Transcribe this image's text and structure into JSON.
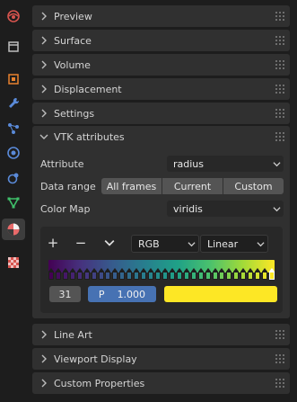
{
  "tabs": [
    {
      "name": "tool-tab",
      "icon": "tool-icon"
    },
    {
      "name": "render-tab",
      "icon": "render-icon"
    },
    {
      "name": "object-tab",
      "icon": "object-icon"
    },
    {
      "name": "modifiers-tab",
      "icon": "wrench-icon"
    },
    {
      "name": "particles-tab",
      "icon": "particles-icon"
    },
    {
      "name": "physics-tab",
      "icon": "physics-icon"
    },
    {
      "name": "constraints-tab",
      "icon": "constraints-icon"
    },
    {
      "name": "data-tab",
      "icon": "vertex-data-icon"
    },
    {
      "name": "material-tab",
      "icon": "material-icon",
      "active": true
    },
    {
      "name": "texture-tab",
      "icon": "texture-icon"
    }
  ],
  "panels": {
    "preview": "Preview",
    "surface": "Surface",
    "volume": "Volume",
    "displacement": "Displacement",
    "settings": "Settings",
    "vtk_attributes": "VTK attributes",
    "line_art": "Line Art",
    "viewport_display": "Viewport Display",
    "custom_properties": "Custom Properties"
  },
  "vtk": {
    "attribute_label": "Attribute",
    "attribute_value": "radius",
    "data_range_label": "Data range",
    "data_range_options": [
      "All frames",
      "Current",
      "Custom"
    ],
    "color_map_label": "Color Map",
    "color_map_value": "viridis"
  },
  "ramp": {
    "add_label": "+",
    "remove_label": "−",
    "color_mode": "RGB",
    "interpolation": "Linear",
    "active_index": "31",
    "position_label": "P",
    "position_value": "1.000",
    "active_color": "#fde725",
    "colormap": [
      "#440154",
      "#46327e",
      "#365c8d",
      "#277f8e",
      "#1fa187",
      "#4ac16d",
      "#a0da39",
      "#fde725"
    ],
    "stop_count": 32
  },
  "colors": {
    "panel_bg": "#303030",
    "window_bg": "#1d1d1d",
    "accent": "#4772b3"
  }
}
